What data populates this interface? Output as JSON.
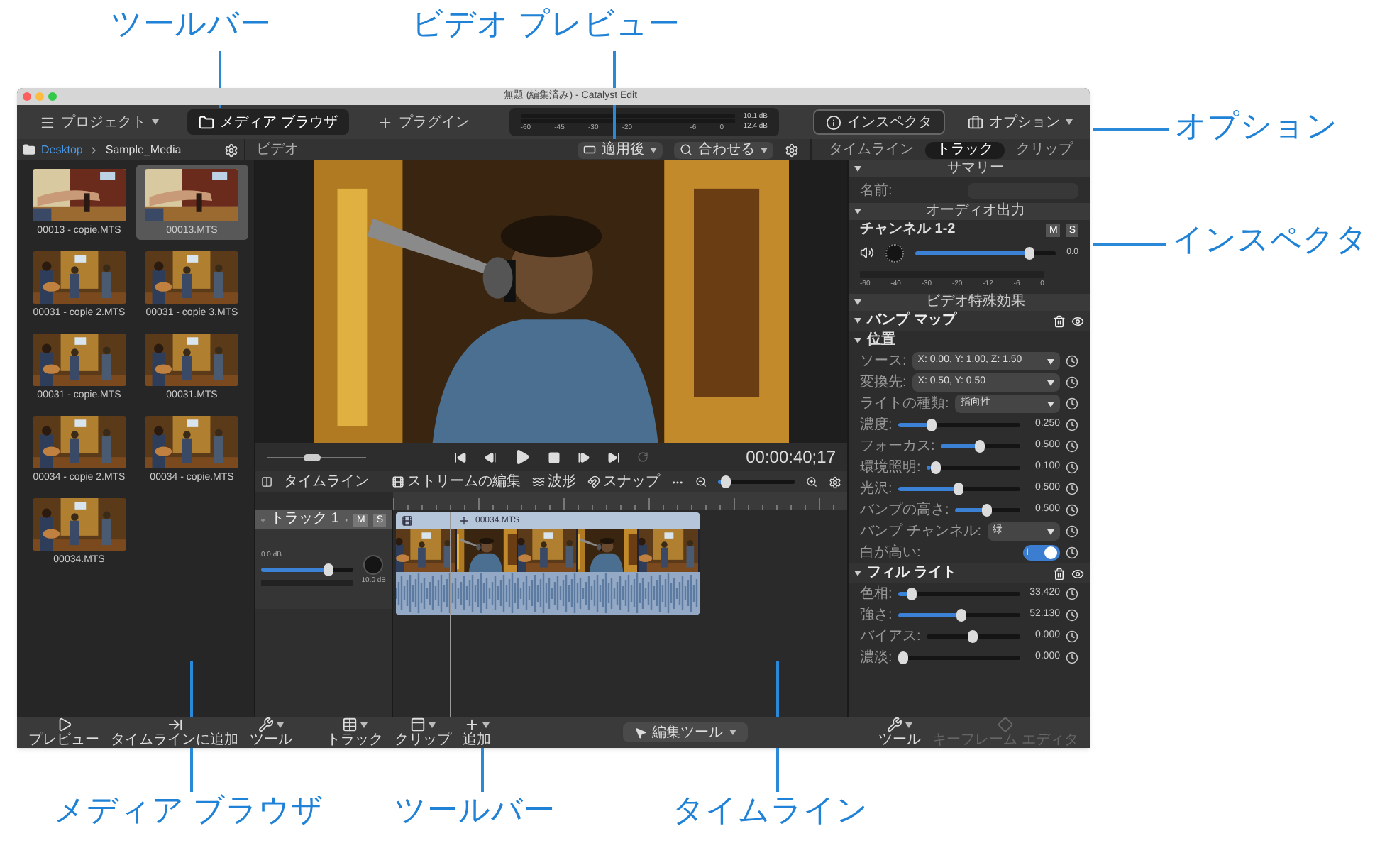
{
  "callouts": [
    {
      "label": "ツールバー"
    },
    {
      "label": "ビデオ プレビュー"
    },
    {
      "label": "オプション"
    },
    {
      "label": "インスペクタ"
    },
    {
      "label": "メディア ブラウザ"
    },
    {
      "label": "ツールバー"
    },
    {
      "label": "タイムライン"
    }
  ],
  "window": {
    "title": "無題 (編集済み) - Catalyst Edit"
  },
  "toolbar": {
    "items": [
      {
        "label": "プロジェクト",
        "selected": false
      },
      {
        "label": "メディア ブラウザ",
        "selected": true
      },
      {
        "label": "プラグイン",
        "selected": false
      }
    ],
    "meter": {
      "readings": [
        "-10.1 dB",
        "-12.4 dB"
      ],
      "scale": [
        "-60",
        "-45",
        "-30",
        "-20",
        "-6",
        "0"
      ]
    },
    "right": [
      {
        "label": "インスペクタ"
      },
      {
        "label": "オプション"
      }
    ]
  },
  "media_browser": {
    "path": [
      "Desktop",
      "Sample_Media"
    ],
    "items": [
      {
        "name": "00013 - copie.MTS",
        "selected": false
      },
      {
        "name": "00013.MTS",
        "selected": true
      },
      {
        "name": "00031 - copie 2.MTS",
        "selected": false
      },
      {
        "name": "00031 - copie 3.MTS",
        "selected": false
      },
      {
        "name": "00031 - copie.MTS",
        "selected": false
      },
      {
        "name": "00031.MTS",
        "selected": false
      },
      {
        "name": "00034 - copie 2.MTS",
        "selected": false
      },
      {
        "name": "00034 - copie.MTS",
        "selected": false
      },
      {
        "name": "00034.MTS",
        "selected": false
      }
    ]
  },
  "preview": {
    "title": "ビデオ",
    "view": "適用後",
    "fit": "合わせる",
    "timecode": "00:00:40;17",
    "shuttle": {
      "level": 0.45
    }
  },
  "timeline": {
    "title": "タイムライン",
    "tools": [
      "ストリームの編集",
      "波形",
      "スナップ"
    ],
    "zoom": {
      "level": 0.05
    },
    "tracks": [
      {
        "name": "トラック 1",
        "mute": "M",
        "solo": "S",
        "gain": "0.0 dB",
        "level": 0.75,
        "pan": "-10.0 dB",
        "clip": "00034.MTS"
      }
    ]
  },
  "inspector": {
    "tabs": [
      {
        "label": "タイムライン",
        "selected": false
      },
      {
        "label": "トラック",
        "selected": true
      },
      {
        "label": "クリップ",
        "selected": false
      }
    ],
    "summary": {
      "title": "サマリー",
      "name_label": "名前:"
    },
    "audio": {
      "title": "オーディオ出力",
      "channel": "チャンネル 1-2",
      "mute": "M",
      "solo": "S",
      "level": 0.84,
      "reading": "0.0",
      "scale": [
        "-60",
        "-40",
        "-30",
        "-20",
        "-12",
        "-6",
        "0"
      ]
    },
    "effects": {
      "title": "ビデオ特殊効果",
      "groups": [
        {
          "title": "バンプ マップ",
          "subgroup": "位置",
          "rows": [
            {
              "kind": "dropdown",
              "label": "ソース:",
              "value": "X: 0.00, Y: 1.00, Z: 1.50"
            },
            {
              "kind": "dropdown",
              "label": "変換先:",
              "value": "X: 0.50, Y: 0.50"
            },
            {
              "kind": "dropdown",
              "label": "ライトの種類:",
              "value": "指向性"
            },
            {
              "kind": "slider",
              "label": "濃度:",
              "level": 0.25,
              "reading": "0.250"
            },
            {
              "kind": "slider",
              "label": "フォーカス:",
              "level": 0.5,
              "reading": "0.500"
            },
            {
              "kind": "slider",
              "label": "環境照明:",
              "level": 0.05,
              "reading": "0.100"
            },
            {
              "kind": "slider",
              "label": "光沢:",
              "level": 0.5,
              "reading": "0.500"
            },
            {
              "kind": "slider",
              "label": "バンプの高さ:",
              "level": 0.5,
              "reading": "0.500"
            },
            {
              "kind": "dropdown",
              "label": "バンプ チャンネル:",
              "value": "緑"
            },
            {
              "kind": "toggle",
              "label": "白が高い:",
              "on": true,
              "text": "I"
            }
          ]
        },
        {
          "title": "フィル ライト",
          "rows": [
            {
              "kind": "slider",
              "label": "色相:",
              "level": 0.08,
              "reading": "33.420"
            },
            {
              "kind": "slider",
              "label": "強さ:",
              "level": 0.52,
              "reading": "52.130"
            },
            {
              "kind": "centered",
              "label": "バイアス:",
              "level": 0.5,
              "reading": "0.000"
            },
            {
              "kind": "slider",
              "label": "濃淡:",
              "level": 0,
              "reading": "0.000"
            }
          ]
        }
      ]
    }
  },
  "bottom_toolbar": {
    "left": [
      {
        "label": "プレビュー",
        "kind": "button",
        "disabled": false
      },
      {
        "label": "タイムラインに追加",
        "kind": "button",
        "disabled": false
      },
      {
        "label": "ツール",
        "kind": "menu",
        "disabled": false
      }
    ],
    "center": [
      {
        "label": "トラック",
        "kind": "menu",
        "disabled": false
      },
      {
        "label": "クリップ",
        "kind": "menu",
        "disabled": false
      },
      {
        "label": "追加",
        "kind": "menu",
        "disabled": false
      }
    ],
    "edit_tool": {
      "label": "編集ツール"
    },
    "right": [
      {
        "label": "ツール",
        "kind": "menu",
        "disabled": false
      },
      {
        "label": "キーフレーム エディタ",
        "kind": "button",
        "disabled": true
      }
    ]
  }
}
